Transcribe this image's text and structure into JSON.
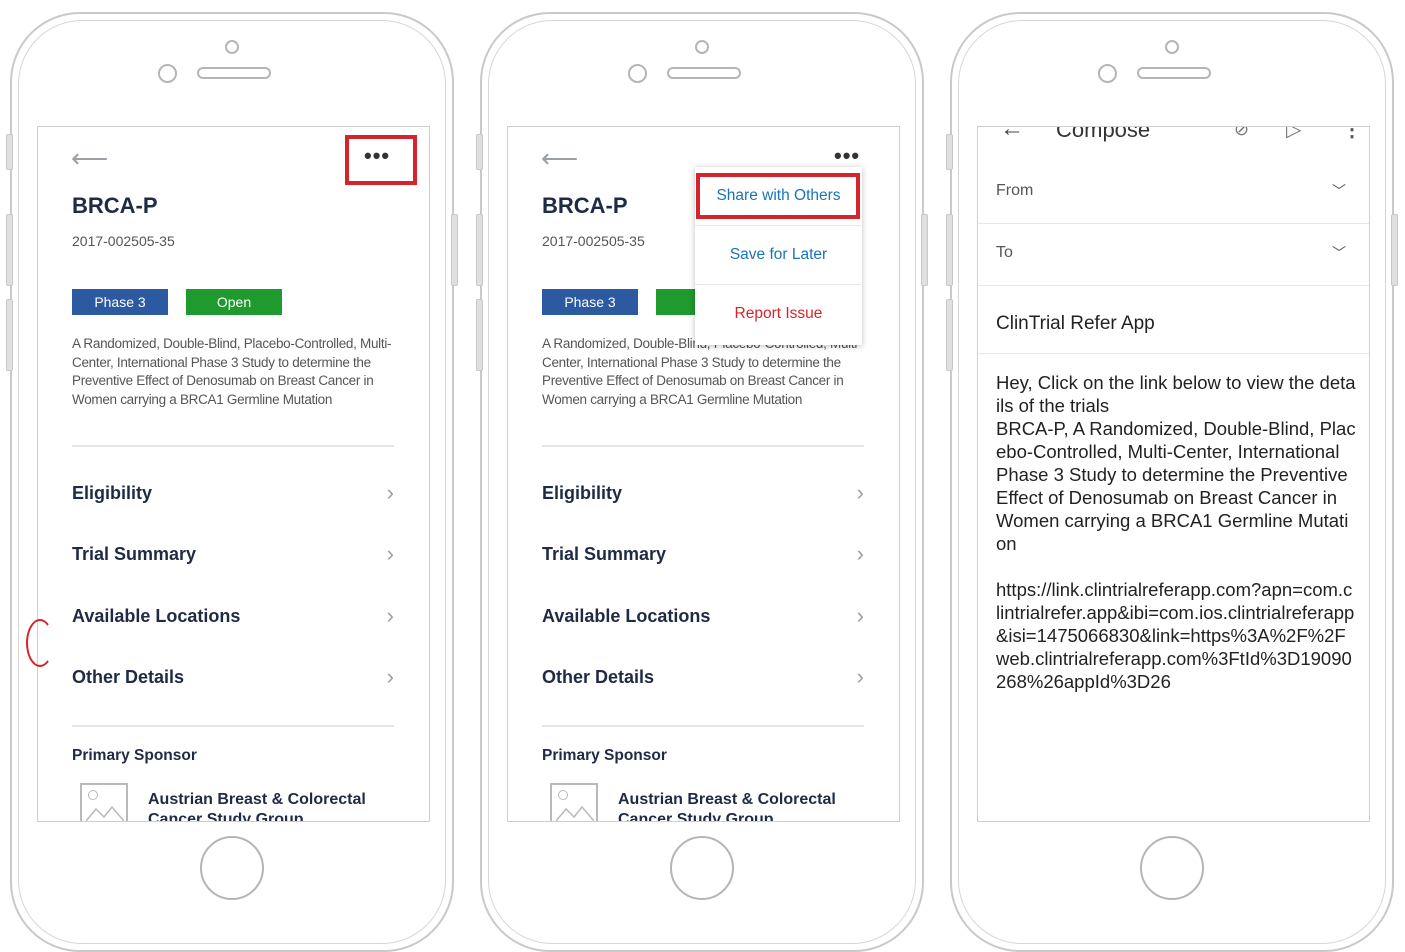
{
  "screen1": {
    "title": "BRCA-P",
    "trial_id": "2017-002505-35",
    "badges": {
      "phase": "Phase 3",
      "status": "Open"
    },
    "description": "A Randomized, Double-Blind, Placebo-Controlled, Multi-Center, International Phase 3 Study to determine the Preventive Effect of Denosumab on Breast Cancer in Women carrying a BRCA1 Germline Mutation",
    "menu": [
      "Eligibility",
      "Trial Summary",
      "Available Locations",
      "Other Details"
    ],
    "sponsor_heading": "Primary Sponsor",
    "sponsor_name": "Austrian Breast & Colorectal Cancer Study Group",
    "more_glyph": "•••"
  },
  "screen2": {
    "title": "BRCA-P",
    "trial_id": "2017-002505-35",
    "badges": {
      "phase": "Phase 3",
      "status": "O"
    },
    "description": "A Randomized, Double-Blind, Placebo-Controlled, Multi-Center, International Phase 3 Study to determine the Preventive Effect of Denosumab on Breast Cancer in Women carrying a BRCA1 Germline Mutation",
    "menu": [
      "Eligibility",
      "Trial Summary",
      "Available Locations",
      "Other Details"
    ],
    "sponsor_heading": "Primary Sponsor",
    "sponsor_name": "Austrian Breast & Colorectal Cancer Study Group",
    "more_glyph": "•••",
    "dropdown": {
      "share": "Share with Others",
      "save": "Save for Later",
      "report": "Report Issue",
      "colors": {
        "share": "#1a73b8",
        "save": "#1a73b8",
        "report": "#d6242c"
      }
    }
  },
  "screen3": {
    "header_title": "Compose",
    "from_label": "From",
    "to_label": "To",
    "subject": "ClinTrial Refer App",
    "body": "Hey, Click on the link below to view the details of the trials\nBRCA-P, A Randomized, Double-Blind, Placebo-Controlled, Multi-Center, International Phase 3 Study to determine the Preventive Effect of Denosumab on Breast Cancer in Women carrying a BRCA1 Germline Mutation\n\nhttps://link.clintrialreferapp.com?apn=com.clintrialrefer.app&ibi=com.ios.clintrialreferapp&isi=1475066830&link=https%3A%2F%2Fweb.clintrialreferapp.com%3FtId%3D19090268%26appId%3D26"
  },
  "colors": {
    "highlight": "#d6242c",
    "phase_badge": "#2c5aa0",
    "open_badge": "#1e9a2f"
  }
}
